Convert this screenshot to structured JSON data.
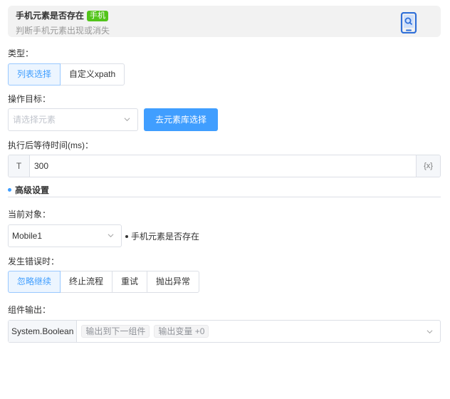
{
  "header": {
    "title": "手机元素是否存在",
    "badge": "手机",
    "subtitle": "判断手机元素出现或消失",
    "icon": "mobile-search-icon"
  },
  "type_field": {
    "label": "类型：",
    "options": [
      "列表选择",
      "自定义xpath"
    ],
    "selected": "列表选择"
  },
  "target_field": {
    "label": "操作目标：",
    "placeholder": "请选择元素",
    "button_label": "去元素库选择"
  },
  "wait_field": {
    "label": "执行后等待时间(ms)：",
    "prefix": "T",
    "value": "300",
    "suffix": "{x}"
  },
  "advanced": {
    "title": "高级设置"
  },
  "current_object": {
    "label": "当前对象：",
    "value": "Mobile1",
    "note": "手机元素是否存在"
  },
  "on_error": {
    "label": "发生错误时：",
    "options": [
      "忽略继续",
      "终止流程",
      "重试",
      "抛出异常"
    ],
    "selected": "忽略继续"
  },
  "output": {
    "label": "组件输出：",
    "type": "System.Boolean",
    "chips": [
      "输出到下一组件",
      "输出变量 +0"
    ]
  },
  "colors": {
    "accent": "#409eff",
    "badge_green": "#52c41a"
  }
}
